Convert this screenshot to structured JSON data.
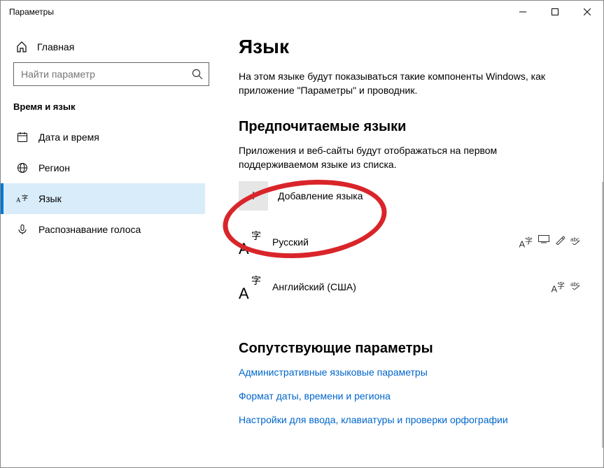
{
  "window": {
    "title": "Параметры"
  },
  "sidebar": {
    "home": "Главная",
    "search_placeholder": "Найти параметр",
    "category": "Время и язык",
    "items": [
      {
        "label": "Дата и время",
        "icon": "calendar"
      },
      {
        "label": "Регион",
        "icon": "globe"
      },
      {
        "label": "Язык",
        "icon": "language",
        "active": true
      },
      {
        "label": "Распознавание голоса",
        "icon": "mic"
      }
    ]
  },
  "main": {
    "title": "Язык",
    "description": "На этом языке будут показываться такие компоненты Windows, как приложение \"Параметры\" и проводник.",
    "preferred_heading": "Предпочитаемые языки",
    "preferred_desc": "Приложения и веб-сайты будут отображаться на первом поддерживаемом языке из списка.",
    "add_language": "Добавление языка",
    "languages": [
      {
        "name": "Русский",
        "glyph": "字",
        "features": [
          "tts",
          "input",
          "handwrite",
          "spell"
        ]
      },
      {
        "name": "Английский (США)",
        "glyph": "字",
        "features": [
          "tts",
          "spell"
        ]
      }
    ],
    "related_heading": "Сопутствующие параметры",
    "links": [
      "Административные языковые параметры",
      "Формат даты, времени и региона",
      "Настройки для ввода, клавиатуры и проверки орфографии"
    ]
  }
}
